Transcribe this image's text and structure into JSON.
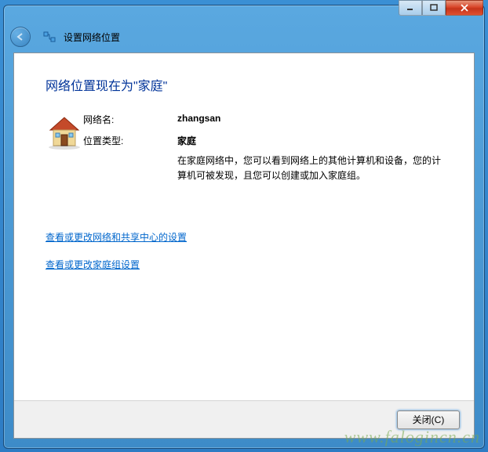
{
  "window": {
    "title": "设置网络位置",
    "controls": {
      "minimize": "minimize",
      "maximize": "maximize",
      "close": "close"
    }
  },
  "content": {
    "heading": "网络位置现在为\"家庭\"",
    "network": {
      "name_label": "网络名:",
      "name_value": "zhangsan",
      "type_label": "位置类型:",
      "type_value": "家庭",
      "description": "在家庭网络中，您可以看到网络上的其他计算机和设备，您的计算机可被发现，且您可以创建或加入家庭组。"
    },
    "links": {
      "link1": "查看或更改网络和共享中心的设置",
      "link2": "查看或更改家庭组设置"
    }
  },
  "footer": {
    "close_button": "关闭(C)"
  },
  "watermark": "www.falogincn.cn"
}
